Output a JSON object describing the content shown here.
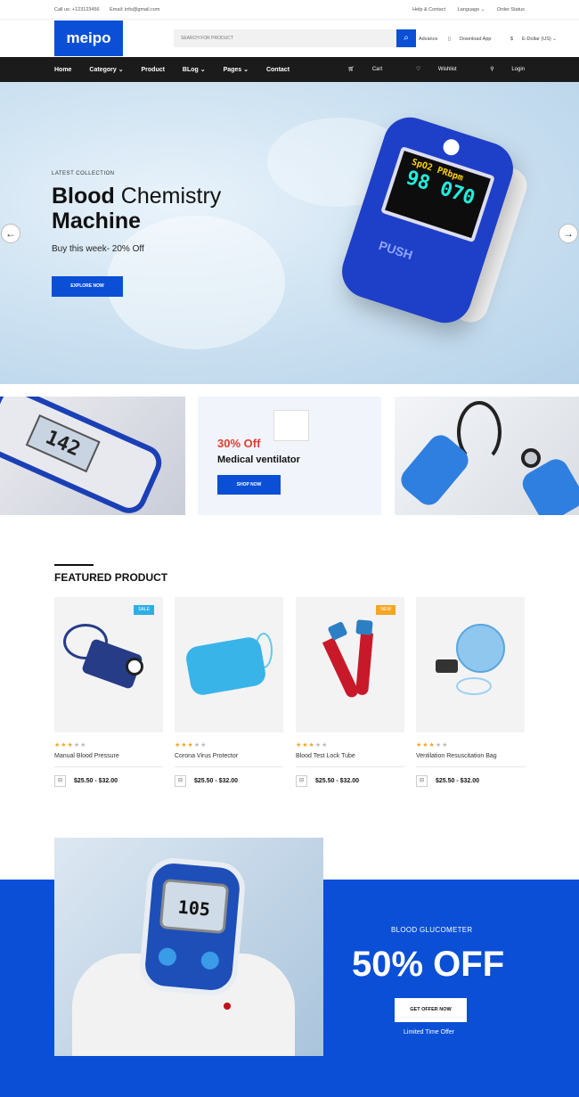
{
  "topbar": {
    "call": "Call us: +123123456",
    "email": "Email: info@gmail.com",
    "help": "Help & Contact",
    "language": "Language ⌄",
    "order_status": "Order Status"
  },
  "header": {
    "logo": "meipo",
    "search_placeholder": "SEARCH FOR PRODUCT",
    "advance": "Advance",
    "download": "Download App",
    "currency": "E-Dollar (US) ⌄"
  },
  "nav": {
    "items": [
      "Home",
      "Category ⌄",
      "Product",
      "BLog ⌄",
      "Pages ⌄",
      "Contact"
    ],
    "cart": "Cart",
    "wishlist": "Wishlist",
    "login": "Login"
  },
  "hero": {
    "eyebrow": "LATEST COLLECTION",
    "title_bold": "Blood",
    "title_rest": " Chemistry",
    "title_line2": "Machine",
    "subtitle": "Buy this week- 20% Off",
    "cta": "EXPLORE NOW",
    "device_reading": "98 070",
    "device_label": "SpO2 PRbpm",
    "device_push": "PUSH"
  },
  "banners": {
    "glucometer_reading": "142",
    "offer": "30% Off",
    "name": "Medical ventilator",
    "cta": "SHOP NOW"
  },
  "featured": {
    "title": "FEATURED PRODUCT",
    "products": [
      {
        "name": "Manual Blood Pressure",
        "price": "$25.50 - $32.00",
        "badge": "SALE",
        "rating": 3
      },
      {
        "name": "Corona Virus Protector",
        "price": "$25.50 - $32.00",
        "badge": "",
        "rating": 3
      },
      {
        "name": "Blood Test Lock Tube",
        "price": "$25.50 - $32.00",
        "badge": "NEW",
        "rating": 3
      },
      {
        "name": "Ventilation Resuscitation Bag",
        "price": "$25.50 - $32.00",
        "badge": "",
        "rating": 3
      }
    ],
    "badge_colors": {
      "SALE": "#2bb0e6",
      "NEW": "#f5a623"
    }
  },
  "promo": {
    "eyebrow": "BLOOD GLUCOMETER",
    "headline": "50% OFF",
    "cta": "GET OFFER NOW",
    "note": "Limited Time Offer",
    "meter_reading": "105"
  },
  "colors": {
    "accent": "#0a4fd6",
    "nav_bg": "#1b1b1b",
    "sale_red": "#e23b2e"
  }
}
